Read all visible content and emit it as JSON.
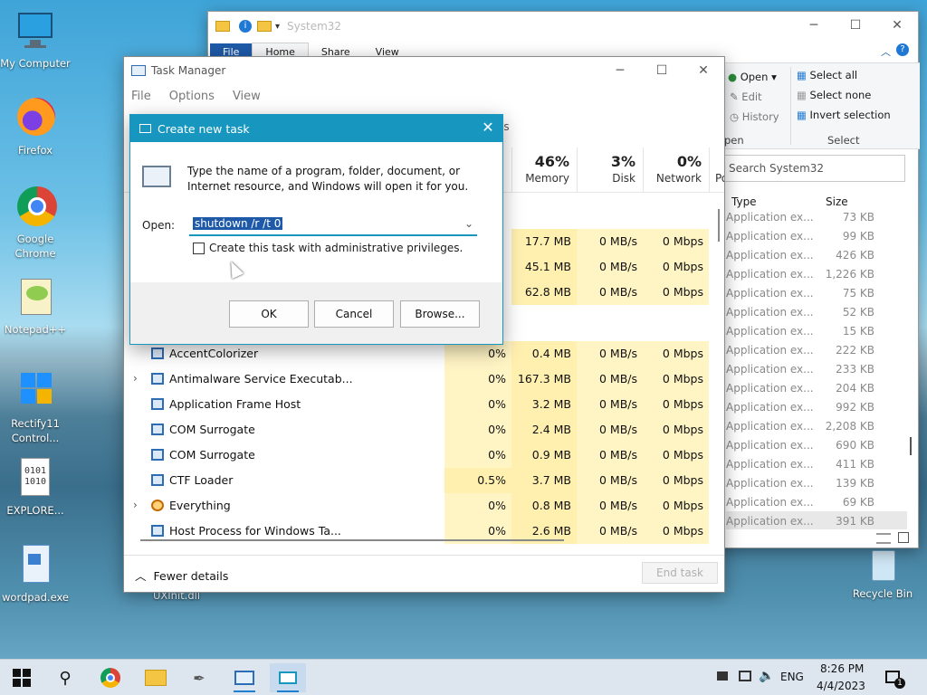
{
  "desktop": {
    "icons": [
      {
        "label": "My Computer"
      },
      {
        "label": "Firefox"
      },
      {
        "label": "Google Chrome"
      },
      {
        "label": "Notepad++"
      },
      {
        "label": "Rectify11 Control..."
      },
      {
        "label": "EXPLORE..."
      },
      {
        "label": "wordpad.exe"
      },
      {
        "label": "UXInit.dll"
      },
      {
        "label": "Recycle Bin"
      }
    ]
  },
  "explorer": {
    "title": "System32",
    "tabs": [
      "File",
      "Home",
      "Share",
      "View"
    ],
    "ribbon": {
      "open": "Open",
      "edit": "Edit",
      "history": "History",
      "open_group": "pen",
      "select_all": "Select all",
      "select_none": "Select none",
      "invert": "Invert selection",
      "select_group": "Select"
    },
    "search_placeholder": "Search System32",
    "columns": {
      "type": "Type",
      "size": "Size"
    },
    "rows": [
      {
        "type": "Application ex...",
        "size": "73 KB"
      },
      {
        "type": "Application ex...",
        "size": "99 KB"
      },
      {
        "type": "Application ex...",
        "size": "426 KB"
      },
      {
        "type": "Application ex...",
        "size": "1,226 KB"
      },
      {
        "type": "Application ex...",
        "size": "75 KB"
      },
      {
        "type": "Application ex...",
        "size": "52 KB"
      },
      {
        "type": "Application ex...",
        "size": "15 KB"
      },
      {
        "type": "Application ex...",
        "size": "222 KB"
      },
      {
        "type": "Application ex...",
        "size": "233 KB"
      },
      {
        "type": "Application ex...",
        "size": "204 KB"
      },
      {
        "type": "Application ex...",
        "size": "992 KB"
      },
      {
        "type": "Application ex...",
        "size": "2,208 KB"
      },
      {
        "type": "Application ex...",
        "size": "690 KB"
      },
      {
        "type": "Application ex...",
        "size": "411 KB"
      },
      {
        "type": "Application ex...",
        "size": "139 KB"
      },
      {
        "type": "Application ex...",
        "size": "69 KB"
      },
      {
        "type": "Application ex...",
        "size": "391 KB"
      }
    ]
  },
  "taskmgr": {
    "title": "Task Manager",
    "menu": [
      "File",
      "Options",
      "View"
    ],
    "tabs_rest": "es",
    "columns": {
      "memory": {
        "pct": "46%",
        "label": "Memory"
      },
      "disk": {
        "pct": "3%",
        "label": "Disk"
      },
      "network": {
        "pct": "0%",
        "label": "Network"
      },
      "power": {
        "label": "Po"
      }
    },
    "top_rows": [
      {
        "mem": "17.7 MB",
        "disk": "0 MB/s",
        "net": "0 Mbps"
      },
      {
        "mem": "45.1 MB",
        "disk": "0 MB/s",
        "net": "0 Mbps"
      },
      {
        "mem": "62.8 MB",
        "disk": "0 MB/s",
        "net": "0 Mbps"
      }
    ],
    "rows": [
      {
        "name": "AccentColorizer",
        "cpu": "0%",
        "mem": "0.4 MB",
        "disk": "0 MB/s",
        "net": "0 Mbps"
      },
      {
        "name": "Antimalware Service Executab...",
        "cpu": "0%",
        "mem": "167.3 MB",
        "disk": "0 MB/s",
        "net": "0 Mbps"
      },
      {
        "name": "Application Frame Host",
        "cpu": "0%",
        "mem": "3.2 MB",
        "disk": "0 MB/s",
        "net": "0 Mbps"
      },
      {
        "name": "COM Surrogate",
        "cpu": "0%",
        "mem": "2.4 MB",
        "disk": "0 MB/s",
        "net": "0 Mbps"
      },
      {
        "name": "COM Surrogate",
        "cpu": "0%",
        "mem": "0.9 MB",
        "disk": "0 MB/s",
        "net": "0 Mbps"
      },
      {
        "name": "CTF Loader",
        "cpu": "0.5%",
        "mem": "3.7 MB",
        "disk": "0 MB/s",
        "net": "0 Mbps"
      },
      {
        "name": "Everything",
        "cpu": "0%",
        "mem": "0.8 MB",
        "disk": "0 MB/s",
        "net": "0 Mbps"
      },
      {
        "name": "Host Process for Windows Ta...",
        "cpu": "0%",
        "mem": "2.6 MB",
        "disk": "0 MB/s",
        "net": "0 Mbps"
      }
    ],
    "fewer_details": "Fewer details",
    "end_task": "End task"
  },
  "run": {
    "title": "Create new task",
    "description": "Type the name of a program, folder, document, or Internet resource, and Windows will open it for you.",
    "open_label": "Open:",
    "input_value": "shutdown /r /t 0",
    "admin_label": "Create this task with administrative privileges.",
    "ok": "OK",
    "cancel": "Cancel",
    "browse": "Browse..."
  },
  "taskbar": {
    "lang": "ENG",
    "time": "8:26 PM",
    "date": "4/4/2023",
    "notification_count": "1"
  }
}
